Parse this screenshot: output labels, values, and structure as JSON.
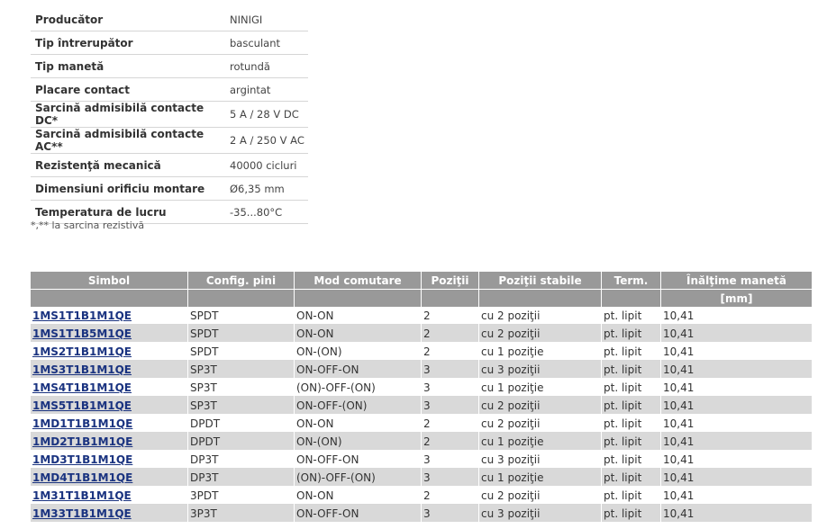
{
  "specs": [
    {
      "label": "Producător",
      "value": "NINIGI"
    },
    {
      "label": "Tip întrerupător",
      "value": "basculant"
    },
    {
      "label": "Tip manetă",
      "value": "rotundă"
    },
    {
      "label": "Placare contact",
      "value": "argintat"
    },
    {
      "label": "Sarcină admisibilă contacte DC*",
      "value": "5 A / 28 V DC"
    },
    {
      "label": "Sarcină admisibilă contacte AC**",
      "value": "2 A / 250 V AC"
    },
    {
      "label": "Rezistenţă mecanică",
      "value": "40000 cicluri"
    },
    {
      "label": "Dimensiuni orificiu montare",
      "value": "Ø6,35 mm"
    },
    {
      "label": "Temperatura de lucru",
      "value": "-35...80°C"
    }
  ],
  "footnote": "*,** la sarcina rezistivă",
  "table": {
    "headers": [
      "Simbol",
      "Config. pini",
      "Mod comutare",
      "Poziţii",
      "Poziţii stabile",
      "Term.",
      "Înălţime manetă"
    ],
    "units": [
      "",
      "",
      "",
      "",
      "",
      "",
      "[mm]"
    ],
    "rows": [
      [
        "1MS1T1B1M1QE",
        "SPDT",
        "ON-ON",
        "2",
        "cu 2 poziţii",
        "pt. lipit",
        "10,41"
      ],
      [
        "1MS1T1B5M1QE",
        "SPDT",
        "ON-ON",
        "2",
        "cu 2 poziţii",
        "pt. lipit",
        "10,41"
      ],
      [
        "1MS2T1B1M1QE",
        "SPDT",
        "ON-(ON)",
        "2",
        "cu 1 poziţie",
        "pt. lipit",
        "10,41"
      ],
      [
        "1MS3T1B1M1QE",
        "SP3T",
        "ON-OFF-ON",
        "3",
        "cu 3 poziţii",
        "pt. lipit",
        "10,41"
      ],
      [
        "1MS4T1B1M1QE",
        "SP3T",
        "(ON)-OFF-(ON)",
        "3",
        "cu 1 poziţie",
        "pt. lipit",
        "10,41"
      ],
      [
        "1MS5T1B1M1QE",
        "SP3T",
        "ON-OFF-(ON)",
        "3",
        "cu 2 poziţii",
        "pt. lipit",
        "10,41"
      ],
      [
        "1MD1T1B1M1QE",
        "DPDT",
        "ON-ON",
        "2",
        "cu 2 poziţii",
        "pt. lipit",
        "10,41"
      ],
      [
        "1MD2T1B1M1QE",
        "DPDT",
        "ON-(ON)",
        "2",
        "cu 1 poziţie",
        "pt. lipit",
        "10,41"
      ],
      [
        "1MD3T1B1M1QE",
        "DP3T",
        "ON-OFF-ON",
        "3",
        "cu 3 poziţii",
        "pt. lipit",
        "10,41"
      ],
      [
        "1MD4T1B1M1QE",
        "DP3T",
        "(ON)-OFF-(ON)",
        "3",
        "cu 1 poziţie",
        "pt. lipit",
        "10,41"
      ],
      [
        "1M31T1B1M1QE",
        "3PDT",
        "ON-ON",
        "2",
        "cu 2 poziţii",
        "pt. lipit",
        "10,41"
      ],
      [
        "1M33T1B1M1QE",
        "3P3T",
        "ON-OFF-ON",
        "3",
        "cu 3 poziţii",
        "pt. lipit",
        "10,41"
      ]
    ]
  }
}
